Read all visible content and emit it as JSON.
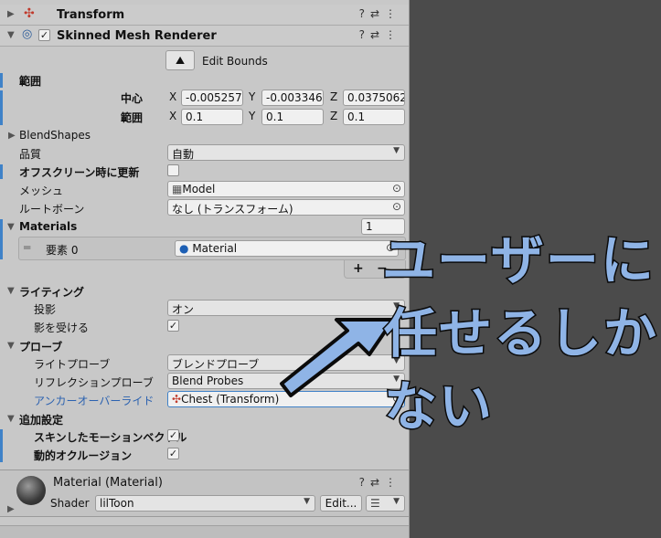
{
  "transform": {
    "title": "Transform"
  },
  "smr": {
    "title": "Skinned Mesh Renderer",
    "edit_bounds": "Edit Bounds",
    "bounds_label": "範囲",
    "center_label": "中心",
    "extent_label": "範囲",
    "center": {
      "x": "-0.0052574",
      "y": "-0.0033466",
      "z": "0.03750629"
    },
    "extent": {
      "x": "0.1",
      "y": "0.1",
      "z": "0.1"
    },
    "axis": {
      "x": "X",
      "y": "Y",
      "z": "Z"
    },
    "blendshapes_label": "BlendShapes",
    "quality_label": "品質",
    "quality_value": "自動",
    "offscreen_label": "オフスクリーン時に更新",
    "mesh_label": "メッシュ",
    "mesh_value": "Model",
    "rootbone_label": "ルートボーン",
    "rootbone_value": "なし (トランスフォーム)",
    "materials_label": "Materials",
    "materials_count": "1",
    "element_label": "要素 0",
    "element_value": "Material",
    "plus": "+",
    "minus": "−",
    "lighting_label": "ライティング",
    "cast_shadows_label": "投影",
    "cast_shadows_value": "オン",
    "receive_shadows_label": "影を受ける",
    "probes_label": "プローブ",
    "light_probes_label": "ライトプローブ",
    "light_probes_value": "ブレンドプローブ",
    "reflection_probes_label": "リフレクションプローブ",
    "reflection_probes_value": "Blend Probes",
    "anchor_override_label": "アンカーオーバーライド",
    "anchor_override_value": "Chest (Transform)",
    "additional_label": "追加設定",
    "skinned_motion_label": "スキンしたモーションベクトル",
    "dynamic_occlusion_label": "動的オクルージョン"
  },
  "material": {
    "title": "Material (Material)",
    "shader_label": "Shader",
    "shader_value": "lilToon",
    "edit_button": "Edit..."
  },
  "overlay": {
    "lines": [
      "ユーザーに",
      "任せるしか",
      "ない"
    ],
    "color": "#8fb4e6"
  },
  "colors": {
    "accent": "#3f82c8",
    "panel": "#c8c8c8",
    "background": "#4b4b4b"
  },
  "icons": {
    "help": "?",
    "settings": "⇄",
    "more": "⋮",
    "check": "✓"
  }
}
